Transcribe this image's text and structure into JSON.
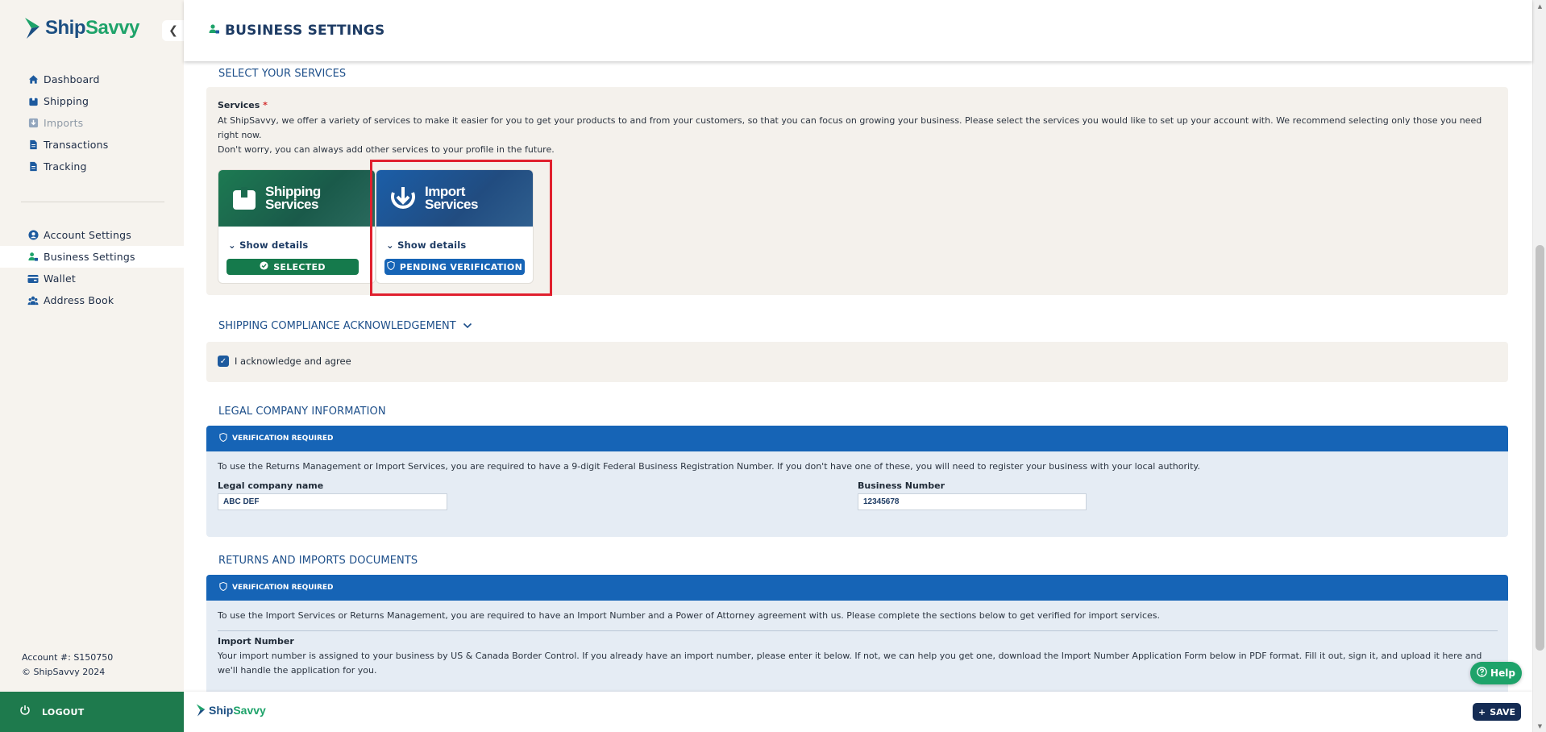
{
  "brand": {
    "name_part1": "Ship",
    "name_part2": "Savvy",
    "accent": "#1ea36a",
    "primary": "#1c4f82"
  },
  "sidebar": {
    "items": [
      {
        "label": "Dashboard",
        "icon": "home-icon"
      },
      {
        "label": "Shipping",
        "icon": "box-icon"
      },
      {
        "label": "Imports",
        "icon": "import-icon"
      },
      {
        "label": "Transactions",
        "icon": "document-icon"
      },
      {
        "label": "Tracking",
        "icon": "document-icon"
      },
      {
        "label": "Account Settings",
        "icon": "user-circle-icon"
      },
      {
        "label": "Business Settings",
        "icon": "business-user-icon"
      },
      {
        "label": "Wallet",
        "icon": "wallet-icon"
      },
      {
        "label": "Address Book",
        "icon": "address-book-icon"
      }
    ],
    "account_number": "Account #: S150750",
    "copyright": "© ShipSavvy 2024",
    "logout_label": "LOGOUT"
  },
  "header": {
    "title": "BUSINESS SETTINGS"
  },
  "services": {
    "heading": "SELECT YOUR SERVICES",
    "label": "Services",
    "required_mark": "*",
    "description_line1": "At ShipSavvy, we offer a variety of services to make it easier for you to get your products to and from your customers, so that you can focus on growing your business. Please select the services you would like to set up your account with. We recommend selecting only those you need right now.",
    "description_line2": "Don't worry, you can always add other services to your profile in the future.",
    "cards": [
      {
        "title_line1": "Shipping",
        "title_line2": "Services",
        "show_details": "Show details",
        "status": "SELECTED",
        "status_color": "#157a4c"
      },
      {
        "title_line1": "Import",
        "title_line2": "Services",
        "show_details": "Show details",
        "status": "PENDING VERIFICATION",
        "status_color": "#1664b6"
      }
    ]
  },
  "compliance": {
    "heading": "SHIPPING COMPLIANCE ACKNOWLEDGEMENT",
    "ack_label": "I acknowledge and agree",
    "checked": true
  },
  "legal": {
    "heading": "LEGAL COMPANY INFORMATION",
    "banner": "VERIFICATION REQUIRED",
    "info": "To use the Returns Management or Import Services, you are required to have a 9-digit Federal Business Registration Number. If you don't have one of these, you will need to register your business with your local authority.",
    "company_label": "Legal company name",
    "company_value": "ABC DEF",
    "business_number_label": "Business Number",
    "business_number_value": "12345678"
  },
  "returns": {
    "heading": "RETURNS AND IMPORTS DOCUMENTS",
    "banner": "VERIFICATION REQUIRED",
    "info": "To use the Import Services or Returns Management, you are required to have an Import Number and a Power of Attorney agreement with us. Please complete the sections below to get verified for import services.",
    "import_number_label": "Import Number",
    "import_number_desc": "Your import number is assigned to your business by US & Canada Border Control. If you already have an import number, please enter it below. If not, we can help you get one, download the Import Number Application Form below in PDF format. Fill it out, sign it, and upload it here and we'll handle the application for you."
  },
  "footer": {
    "save_label": "SAVE",
    "help_label": "Help"
  }
}
